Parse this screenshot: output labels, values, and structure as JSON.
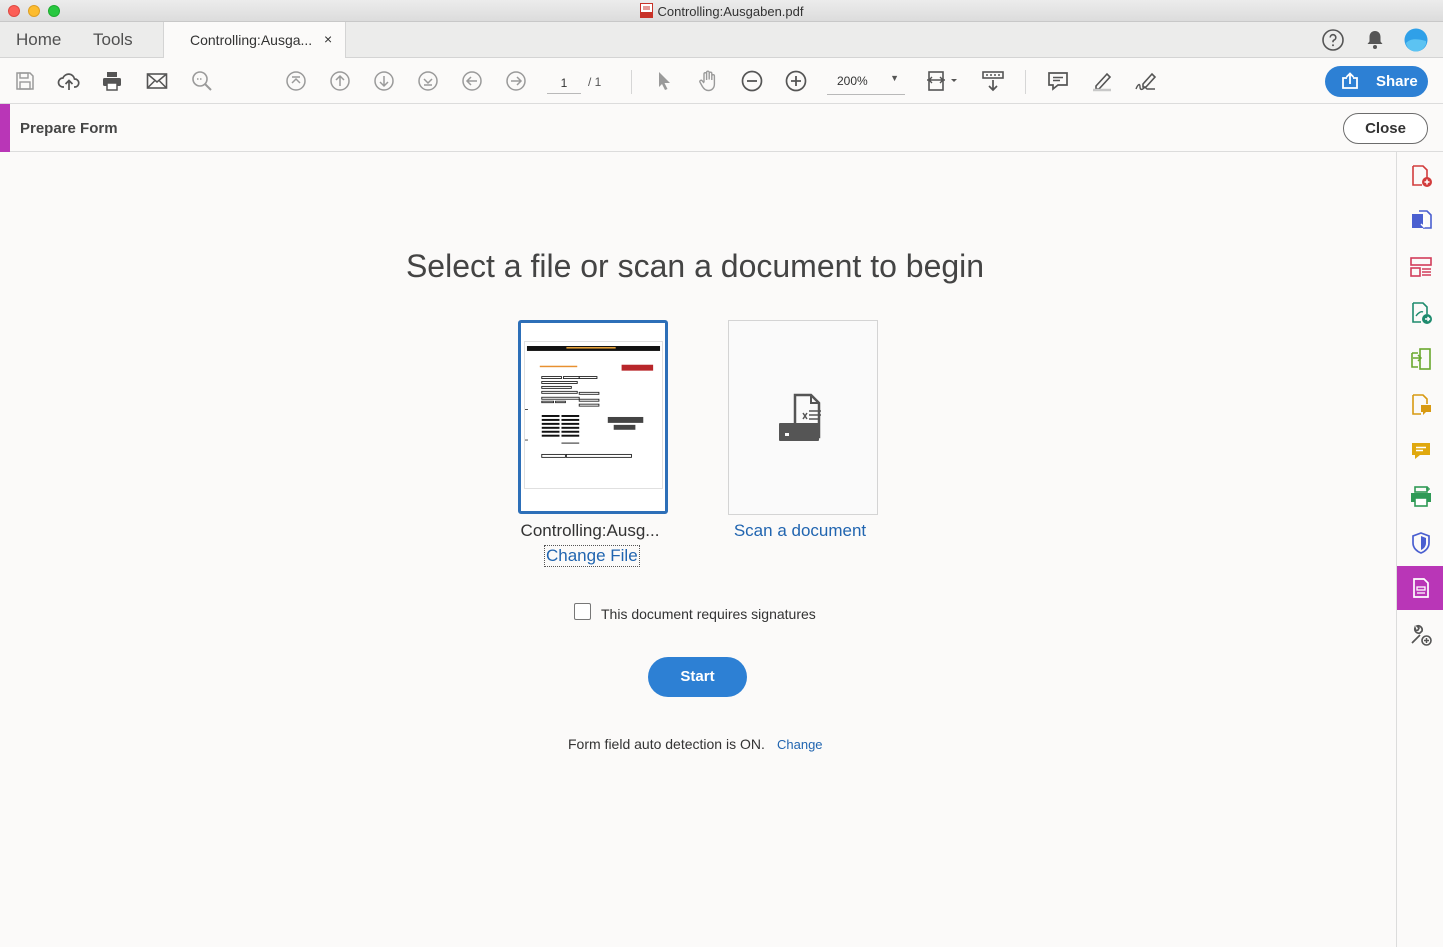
{
  "window": {
    "title": "Controlling:Ausgaben.pdf"
  },
  "tabs": {
    "home": "Home",
    "tools": "Tools",
    "document_tab": "Controlling:Ausga...",
    "close_glyph": "×"
  },
  "toolbar": {
    "page_current": "1",
    "page_total": "/ 1",
    "zoom": "200%",
    "zoom_caret": "▼",
    "share_label": "Share"
  },
  "tool_bar": {
    "title": "Prepare Form",
    "close_label": "Close"
  },
  "main": {
    "heading": "Select a file or scan a document to begin",
    "file_name": "Controlling:Ausg...",
    "change_file": "Change File",
    "scan_label": "Scan a document",
    "signature_label": "This document requires signatures",
    "signature_checked": false,
    "start_label": "Start",
    "autodetect_text": "Form field auto detection is ON.",
    "change_label": "Change"
  },
  "icons": {
    "toolbar": [
      "save-icon",
      "upload-icon",
      "print-icon",
      "email-icon",
      "zoom-search-icon",
      "first-page-icon",
      "prev-page-icon",
      "next-page-icon",
      "last-page-icon",
      "back-icon",
      "forward-icon",
      "select-cursor-icon",
      "hand-icon",
      "zoom-out-icon",
      "zoom-in-icon",
      "fit-page-icon",
      "scroll-mode-icon",
      "comment-icon",
      "highlight-icon",
      "sign-icon"
    ],
    "sidebar": [
      "create-pdf-icon",
      "export-pdf-icon",
      "organize-pages-icon",
      "edit-pdf-icon",
      "compare-icon",
      "send-for-comments-icon",
      "comment-tool-icon",
      "print-production-icon",
      "protect-icon",
      "prepare-form-icon",
      "more-tools-icon"
    ]
  },
  "colors": {
    "accent_purple": "#b936b7",
    "primary_blue": "#2d80d4",
    "link_blue": "#2165b0"
  }
}
